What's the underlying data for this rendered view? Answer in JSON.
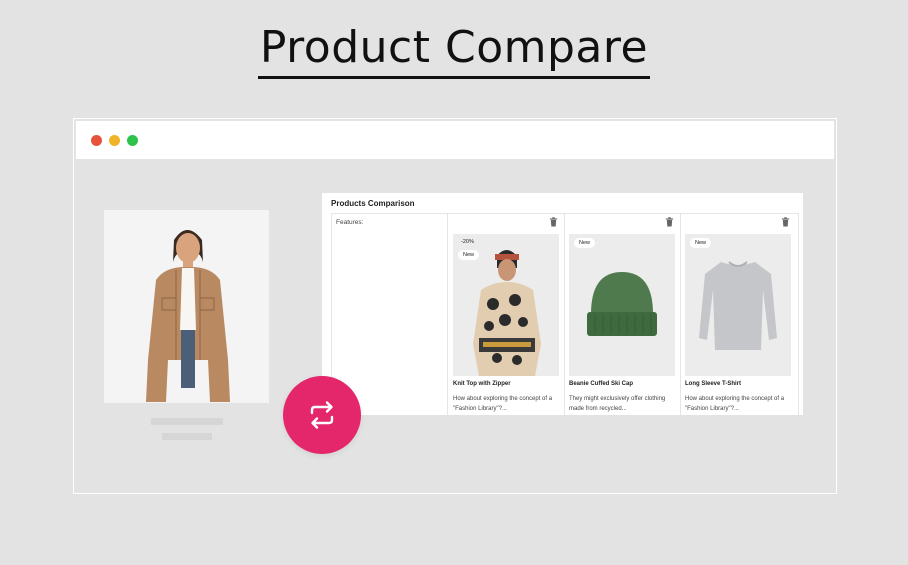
{
  "headline": "Product Compare",
  "window": {
    "traffic_lights": {
      "close": "#e5533d",
      "minimize": "#f0b429",
      "maximize": "#2dc24b"
    }
  },
  "comparison": {
    "title": "Products Comparison",
    "features_label": "Features:",
    "products": [
      {
        "name": "Knit Top with Zipper",
        "description": "How about exploring the concept of a \"Fashion Library\"?...",
        "badges": [
          "-20%",
          "New"
        ],
        "image_icon": "patterned-knit-top-image"
      },
      {
        "name": "Beanie Cuffed Ski Cap",
        "description": "They might exclusively offer clothing made from recycled...",
        "badges": [
          "New"
        ],
        "image_icon": "green-beanie-image"
      },
      {
        "name": "Long Sleeve T-Shirt",
        "description": "How about exploring the concept of a \"Fashion Library\"?...",
        "badges": [
          "New"
        ],
        "image_icon": "gray-long-sleeve-shirt-image"
      }
    ]
  },
  "swap_button": {
    "icon": "swap-arrows-icon",
    "color": "#e3276a"
  }
}
